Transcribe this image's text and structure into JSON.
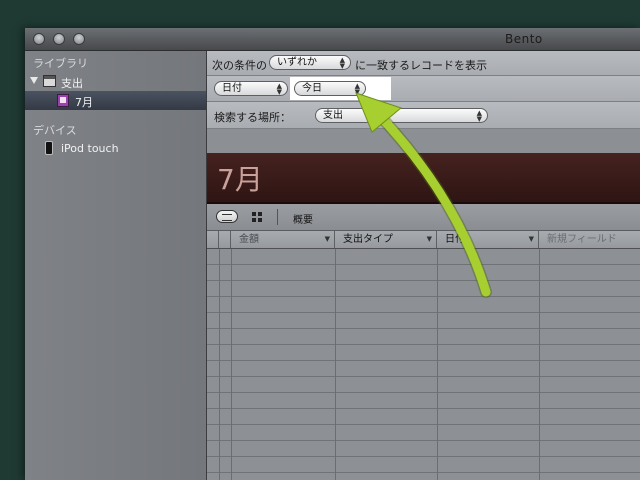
{
  "window": {
    "title": "Bento"
  },
  "sidebar": {
    "library_heading": "ライブラリ",
    "library_item": "支出",
    "smart_collection": "7月",
    "devices_heading": "デバイス",
    "device_item": "iPod touch"
  },
  "criteria": {
    "prefix": "次の条件の",
    "match_select": "いずれか",
    "suffix": "に一致するレコードを表示",
    "field_select": "日付",
    "value_select": "今日",
    "search_label": "検索する場所：",
    "search_select": "支出"
  },
  "banner": {
    "title": "7月"
  },
  "toolbar": {
    "summary_label": "概要"
  },
  "table": {
    "columns": [
      "金額",
      "支出タイプ",
      "日付",
      "新規フィールド"
    ]
  },
  "colors": {
    "arrow": "#a6cf2f",
    "banner_bg": "#3a1b19",
    "sidebar_selected": "#3e4552"
  },
  "annotation": {
    "type": "arrow",
    "target": "value_select"
  }
}
